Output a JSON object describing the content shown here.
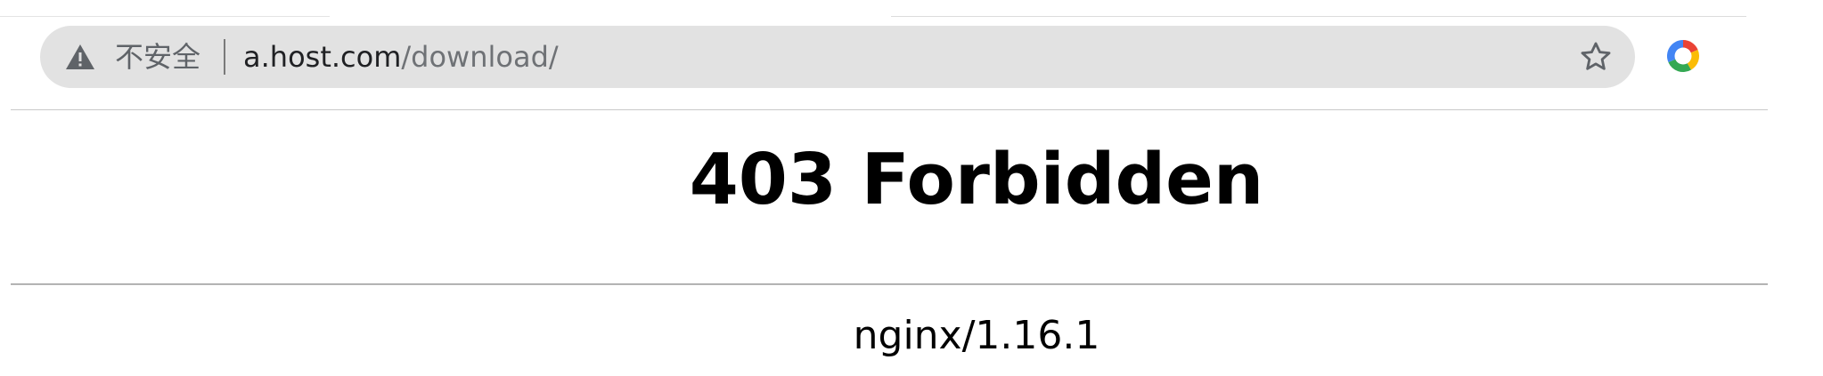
{
  "browser": {
    "address_bar": {
      "security_label": "不安全",
      "url_host": "a.host.com",
      "url_path": "/download/"
    },
    "icons": {
      "security": "warning-triangle-icon",
      "bookmark": "star-icon",
      "extension": "chrome-ring-icon"
    },
    "colors": {
      "omnibox_bg": "#e2e2e2",
      "url_host": "#202124",
      "url_path": "#6f7276"
    }
  },
  "page": {
    "heading": "403 Forbidden",
    "server": "nginx/1.16.1"
  }
}
